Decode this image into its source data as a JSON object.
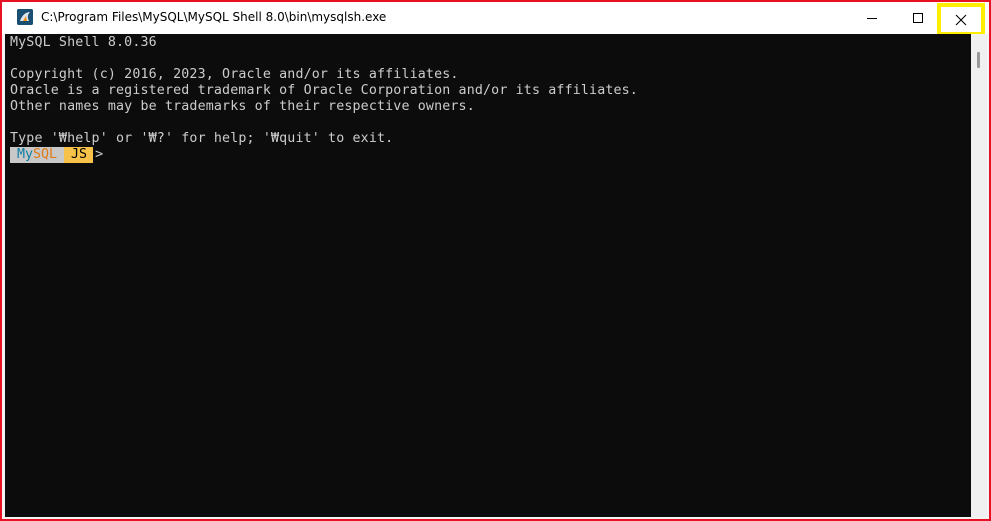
{
  "window": {
    "title": "C:\\Program Files\\MySQL\\MySQL Shell 8.0\\bin\\mysqlsh.exe",
    "app_icon": "mysql-shell-icon",
    "controls": {
      "minimize_icon": "minimize-icon",
      "maximize_icon": "maximize-icon",
      "close_icon": "close-icon"
    },
    "border_color": "#e81123",
    "highlight_color": "#ffee00"
  },
  "terminal": {
    "background": "#0c0c0c",
    "foreground": "#cccccc",
    "lines": [
      "MySQL Shell 8.0.36",
      "",
      "Copyright (c) 2016, 2023, Oracle and/or its affiliates.",
      "Oracle is a registered trademark of Oracle Corporation and/or its affiliates.",
      "Other names may be trademarks of their respective owners.",
      "",
      "Type '₩help' or '₩?' for help; '₩quit' to exit."
    ],
    "prompt": {
      "my": "My",
      "sql": "SQL",
      "mode": "JS",
      "arrow": ">"
    }
  }
}
